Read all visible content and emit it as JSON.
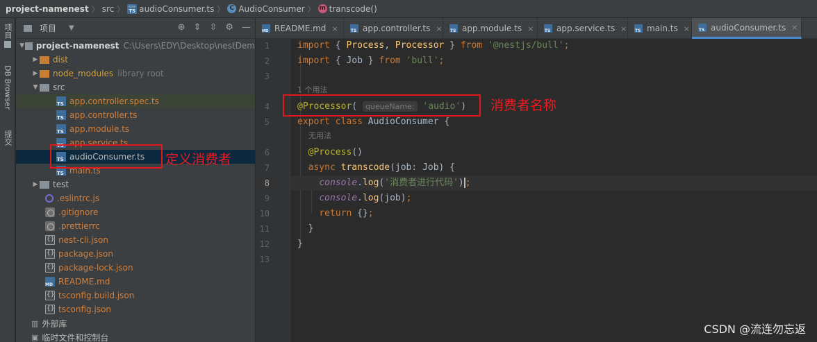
{
  "breadcrumb": {
    "project": "project-namenest",
    "folder": "src",
    "file": "audioConsumer.ts",
    "class": "AudioConsumer",
    "method": "transcode()"
  },
  "left_strip": {
    "project_tab": "项目",
    "db_browser_tab": "DB Browser",
    "commit_tab": "提交"
  },
  "project_panel": {
    "title": "项目",
    "root": {
      "name": "project-namenest",
      "path": "C:\\Users\\EDY\\Desktop\\nestDem"
    },
    "tree": [
      {
        "name": "dist",
        "color": "gold",
        "hint": ""
      },
      {
        "name": "node_modules",
        "color": "gold",
        "hint": "library root"
      },
      {
        "name": "src",
        "color": "white",
        "hint": ""
      },
      {
        "name": "app.controller.spec.ts",
        "color": "orange",
        "hint": ""
      },
      {
        "name": "app.controller.ts",
        "color": "orange",
        "hint": ""
      },
      {
        "name": "app.module.ts",
        "color": "orange",
        "hint": ""
      },
      {
        "name": "app.service.ts",
        "color": "orange",
        "hint": ""
      },
      {
        "name": "audioConsumer.ts",
        "color": "white",
        "hint": ""
      },
      {
        "name": "main.ts",
        "color": "orange",
        "hint": ""
      },
      {
        "name": "test",
        "color": "white",
        "hint": ""
      },
      {
        "name": ".eslintrc.js",
        "color": "orange",
        "hint": ""
      },
      {
        "name": ".gitignore",
        "color": "orange",
        "hint": ""
      },
      {
        "name": ".prettierrc",
        "color": "orange",
        "hint": ""
      },
      {
        "name": "nest-cli.json",
        "color": "orange",
        "hint": ""
      },
      {
        "name": "package.json",
        "color": "orange",
        "hint": ""
      },
      {
        "name": "package-lock.json",
        "color": "orange",
        "hint": ""
      },
      {
        "name": "README.md",
        "color": "orange",
        "hint": ""
      },
      {
        "name": "tsconfig.build.json",
        "color": "orange",
        "hint": ""
      },
      {
        "name": "tsconfig.json",
        "color": "orange",
        "hint": ""
      }
    ],
    "external_libraries": "外部库",
    "scratches": "临时文件和控制台"
  },
  "tabs": [
    {
      "label": "README.md",
      "type": "md"
    },
    {
      "label": "app.controller.ts",
      "type": "ts"
    },
    {
      "label": "app.module.ts",
      "type": "ts"
    },
    {
      "label": "app.service.ts",
      "type": "ts"
    },
    {
      "label": "main.ts",
      "type": "ts"
    },
    {
      "label": "audioConsumer.ts",
      "type": "ts",
      "active": true
    }
  ],
  "editor": {
    "line_numbers": [
      "1",
      "2",
      "3",
      "4",
      "5",
      "6",
      "7",
      "8",
      "9",
      "10",
      "11",
      "12",
      "13"
    ],
    "usage_hint_1": "1 个用法",
    "usage_hint_2": "无用法",
    "inlay_queue_name": "queueName:",
    "current_line": 8
  },
  "annotations": {
    "consumer_name": "消费者名称",
    "define_consumer": "定义消费者"
  },
  "watermark": "CSDN @流连勿忘返",
  "colors": {
    "keyword": "#cc7832",
    "string": "#6a8759",
    "function": "#ffc66d",
    "decorator": "#bbb529",
    "annotation_red": "#ec1c24",
    "selection": "#0d293e"
  }
}
